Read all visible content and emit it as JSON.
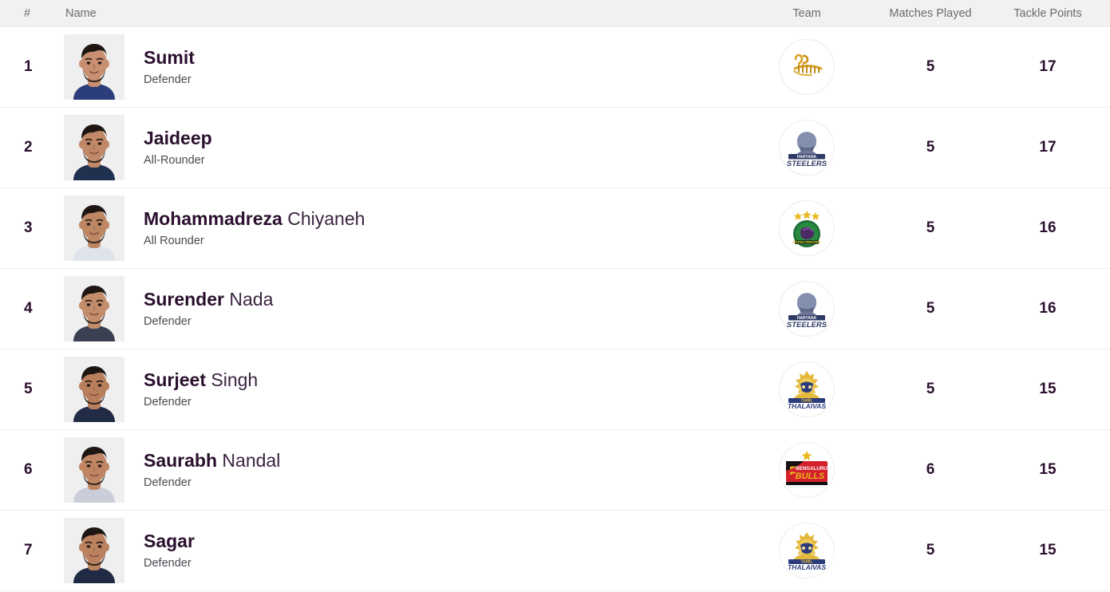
{
  "header": {
    "rank": "#",
    "name": "Name",
    "team": "Team",
    "matches_played": "Matches Played",
    "tackle_points": "Tackle Points"
  },
  "colors": {
    "header_bg": "#f1f1f1",
    "header_text": "#6b6b72",
    "row_bg": "#ffffff",
    "row_divider": "#ededed",
    "primary_text": "#2b0f2e",
    "secondary_text": "#4a4a52"
  },
  "rows": [
    {
      "rank": "1",
      "first_name": "Sumit",
      "last_name": "",
      "role": "Defender",
      "team": "UP Yoddhas",
      "team_logo": "up-yoddhas-logo",
      "matches_played": "5",
      "tackle_points": "17"
    },
    {
      "rank": "2",
      "first_name": "Jaideep",
      "last_name": "",
      "role": "All-Rounder",
      "team": "Haryana Steelers",
      "team_logo": "haryana-steelers-logo",
      "matches_played": "5",
      "tackle_points": "17"
    },
    {
      "rank": "3",
      "first_name": "Mohammadreza",
      "last_name": "Chiyaneh",
      "role": "All Rounder",
      "team": "Patna Pirates",
      "team_logo": "patna-pirates-logo",
      "matches_played": "5",
      "tackle_points": "16"
    },
    {
      "rank": "4",
      "first_name": "Surender",
      "last_name": "Nada",
      "role": "Defender",
      "team": "Haryana Steelers",
      "team_logo": "haryana-steelers-logo",
      "matches_played": "5",
      "tackle_points": "16"
    },
    {
      "rank": "5",
      "first_name": "Surjeet",
      "last_name": "Singh",
      "role": "Defender",
      "team": "Tamil Thalaivas",
      "team_logo": "tamil-thalaivas-logo",
      "matches_played": "5",
      "tackle_points": "15"
    },
    {
      "rank": "6",
      "first_name": "Saurabh",
      "last_name": "Nandal",
      "role": "Defender",
      "team": "Bengaluru Bulls",
      "team_logo": "bengaluru-bulls-logo",
      "matches_played": "6",
      "tackle_points": "15"
    },
    {
      "rank": "7",
      "first_name": "Sagar",
      "last_name": "",
      "role": "Defender",
      "team": "Tamil Thalaivas",
      "team_logo": "tamil-thalaivas-logo",
      "matches_played": "5",
      "tackle_points": "15"
    }
  ]
}
